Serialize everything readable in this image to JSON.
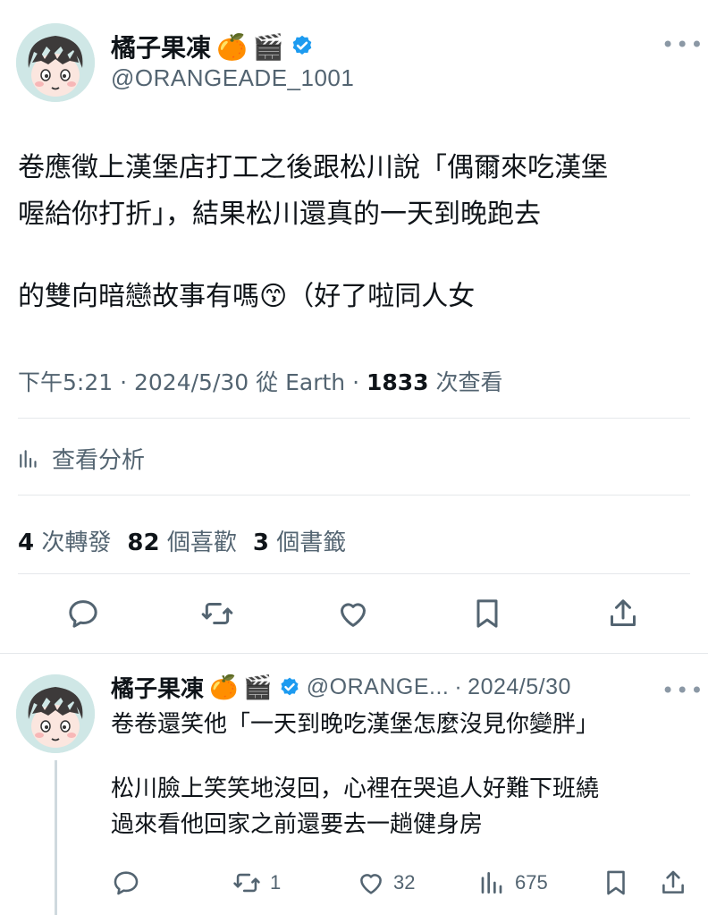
{
  "main_tweet": {
    "author_name": "橘子果凍",
    "emoji_orange": "🍊",
    "emoji_clapper": "🎬",
    "handle": "@ORANGEADE_1001",
    "more_label": "•••",
    "text_line1": "卷應徵上漢堡店打工之後跟松川說「偶爾來吃漢堡",
    "text_line2": "喔給你打折」，結果松川還真的一天到晚跑去",
    "text_line3": "的雙向暗戀故事有嗎😙（好了啦同人女",
    "time": "下午5:21",
    "date": "2024/5/30",
    "source": "從 Earth",
    "views_count": "1833",
    "views_label": "次查看",
    "analytics_label": "查看分析",
    "retweets_count": "4",
    "retweets_label": "次轉發",
    "likes_count": "82",
    "likes_label": "個喜歡",
    "bookmarks_count": "3",
    "bookmarks_label": "個書籤"
  },
  "reply": {
    "author_name": "橘子果凍",
    "emoji_orange": "🍊",
    "emoji_clapper": "🎬",
    "handle": "@ORANGE...",
    "date": "2024/5/30",
    "more_label": "•••",
    "text_line1": "卷卷還笑他「一天到晚吃漢堡怎麼沒見你變胖」",
    "text_line2": "松川臉上笑笑地沒回，心裡在哭追人好難下班繞",
    "text_line3": "過來看他回家之前還要去一趟健身房",
    "retweet_count": "1",
    "like_count": "32",
    "view_count": "675"
  },
  "colors": {
    "verified": "#1d9bf0",
    "text": "#0f1419",
    "muted": "#536471",
    "divider": "#e5e8eb"
  },
  "icons": [
    "reply-icon",
    "retweet-icon",
    "like-icon",
    "bookmark-icon",
    "share-icon",
    "analytics-icon",
    "verified-icon"
  ]
}
